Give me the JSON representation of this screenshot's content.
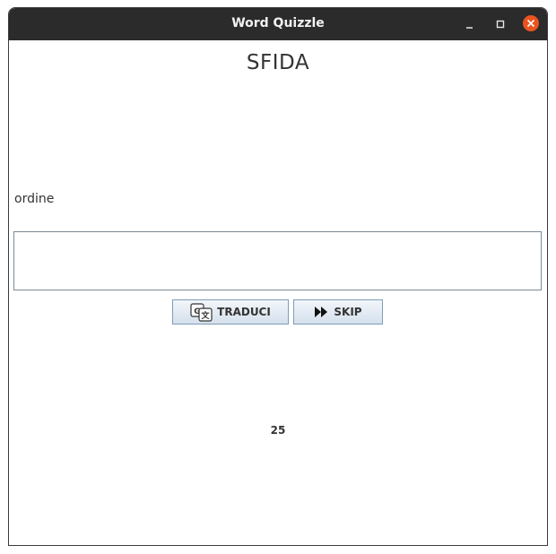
{
  "window": {
    "title": "Word Quizzle",
    "accent_close": "#e95420"
  },
  "main": {
    "heading": "SFIDA",
    "word": "ordine",
    "answer_value": "",
    "translate_label": "TRADUCI",
    "skip_label": "SKIP",
    "counter": "25"
  },
  "icons": {
    "minimize": "minimize-icon",
    "maximize": "maximize-icon",
    "close": "close-icon",
    "translate": "translate-icon",
    "skip": "fast-forward-icon"
  }
}
